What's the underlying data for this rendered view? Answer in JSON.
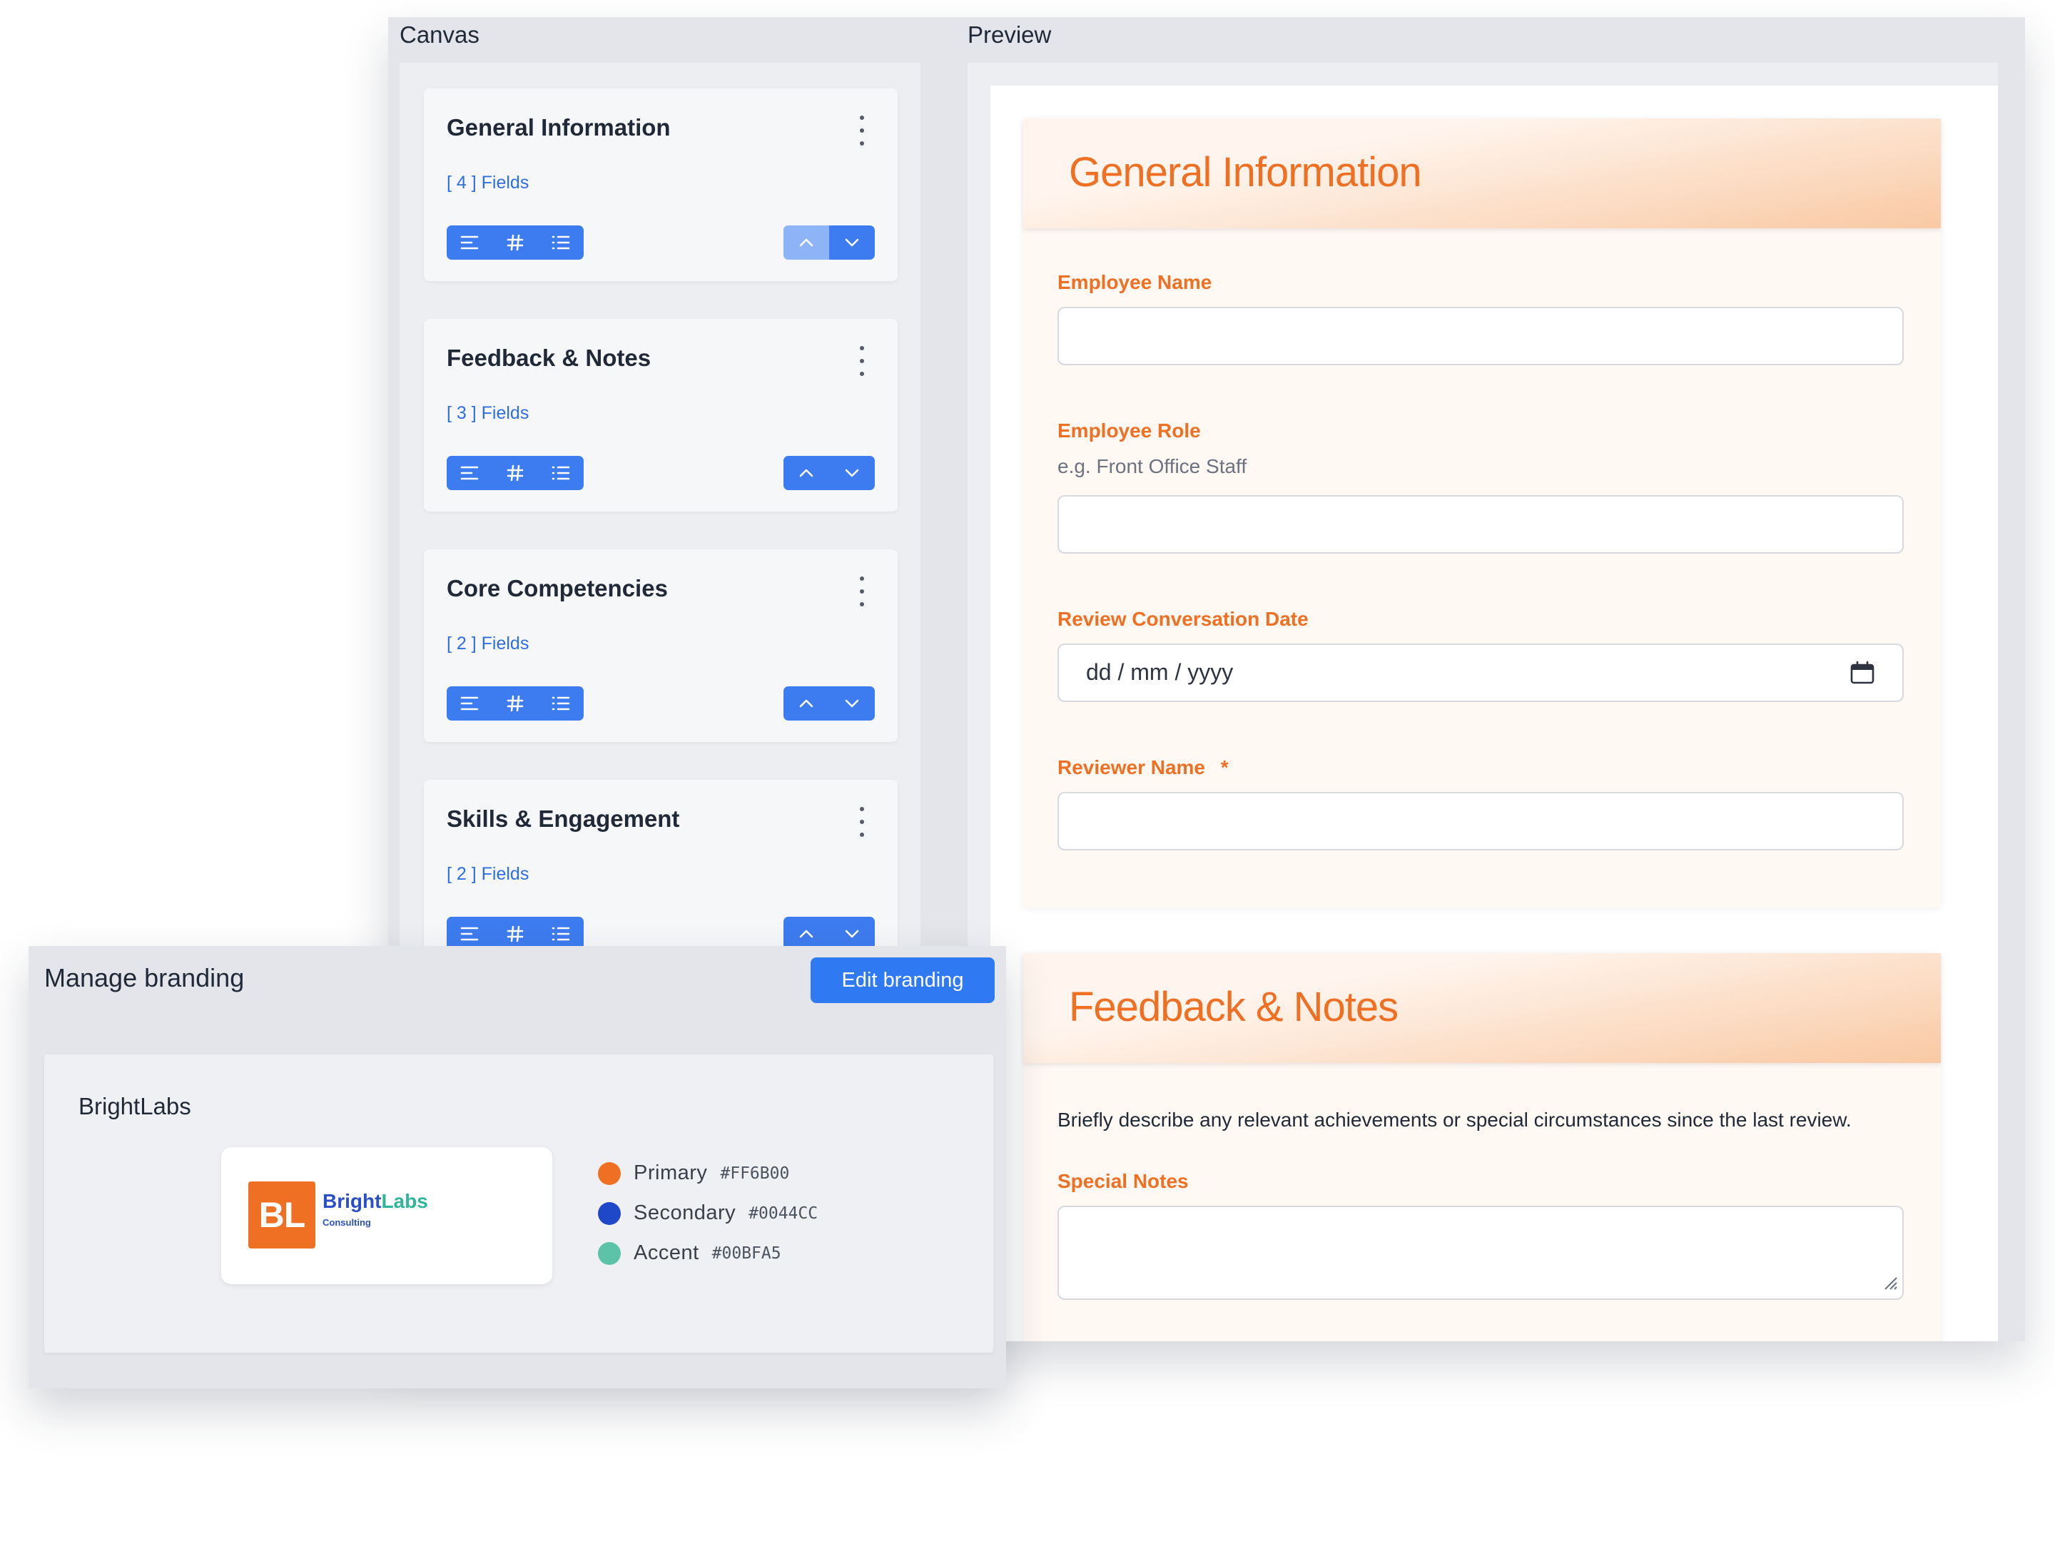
{
  "canvas": {
    "heading": "Canvas",
    "sections": [
      {
        "title": "General Information",
        "fields": "[ 4 ] Fields"
      },
      {
        "title": "Feedback & Notes",
        "fields": "[ 3 ] Fields"
      },
      {
        "title": "Core Competencies",
        "fields": "[ 2 ] Fields"
      },
      {
        "title": "Skills & Engagement",
        "fields": "[ 2 ] Fields"
      }
    ]
  },
  "preview": {
    "heading": "Preview",
    "general": {
      "title": "General Information",
      "employee_name_label": "Employee Name",
      "employee_role_label": "Employee Role",
      "employee_role_hint": "e.g. Front Office Staff",
      "review_date_label": "Review Conversation Date",
      "review_date_value": "dd / mm / yyyy",
      "reviewer_name_label": "Reviewer Name",
      "required_marker": "*"
    },
    "feedback": {
      "title": "Feedback & Notes",
      "description": "Briefly describe any relevant achievements or special circumstances since the last review.",
      "special_notes_label": "Special Notes"
    }
  },
  "branding": {
    "title": "Manage branding",
    "edit_button": "Edit branding",
    "brand_name": "BrightLabs",
    "logo": {
      "mark": "BL",
      "word_part1": "Bright",
      "word_part2": "Labs",
      "subtitle": "Consulting"
    },
    "colors": [
      {
        "label": "Primary",
        "hex": "#FF6B00",
        "swatch": "#F07023"
      },
      {
        "label": "Secondary",
        "hex": "#0044CC",
        "swatch": "#1F48C8"
      },
      {
        "label": "Accent",
        "hex": "#00BFA5",
        "swatch": "#5CC3A8"
      }
    ]
  },
  "icons": {
    "kebab": "more-vertical-icon",
    "text_tool": "align-left-icon",
    "number_tool": "hash-icon",
    "list_tool": "list-icon",
    "up": "chevron-up-icon",
    "down": "chevron-down-icon",
    "calendar": "calendar-icon"
  }
}
